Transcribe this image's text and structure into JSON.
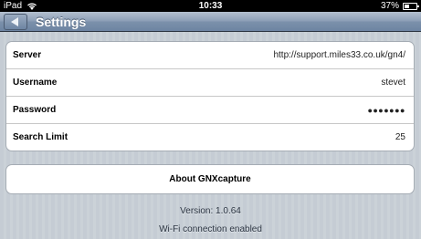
{
  "statusbar": {
    "carrier": "iPad",
    "time": "10:33",
    "battery": "37%"
  },
  "navbar": {
    "title": "Settings",
    "back_icon": "back-arrow-icon"
  },
  "settings": {
    "rows": [
      {
        "label": "Server",
        "value": "http://support.miles33.co.uk/gn4/"
      },
      {
        "label": "Username",
        "value": "stevet"
      },
      {
        "label": "Password",
        "value": "●●●●●●●"
      },
      {
        "label": "Search Limit",
        "value": "25"
      }
    ]
  },
  "about_button": {
    "label": "About GNXcapture"
  },
  "footer": {
    "version": "Version: 1.0.64",
    "wifi": "Wi-Fi connection enabled"
  },
  "colors": {
    "navbar": "#6d84a2",
    "background": "#c5ccd4"
  }
}
